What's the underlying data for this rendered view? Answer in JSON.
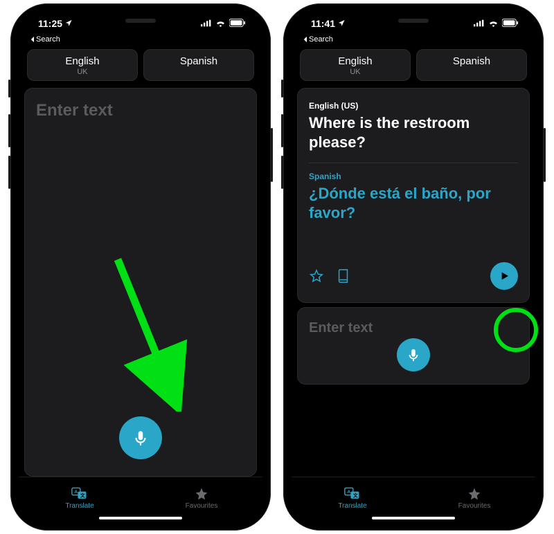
{
  "colors": {
    "accent": "#2aa6c9",
    "annotation": "#00e015"
  },
  "left": {
    "status": {
      "time": "11:25",
      "back_label": "Search"
    },
    "lang_from": {
      "name": "English",
      "region": "UK"
    },
    "lang_to": {
      "name": "Spanish",
      "region": ""
    },
    "placeholder": "Enter text",
    "tabs": {
      "translate": "Translate",
      "favourites": "Favourites"
    }
  },
  "right": {
    "status": {
      "time": "11:41",
      "back_label": "Search"
    },
    "lang_from": {
      "name": "English",
      "region": "UK"
    },
    "lang_to": {
      "name": "Spanish",
      "region": ""
    },
    "result": {
      "source_lang": "English (US)",
      "source_text": "Where is the restroom please?",
      "target_lang": "Spanish",
      "target_text": "¿Dónde está el baño, por favor?"
    },
    "placeholder": "Enter text",
    "tabs": {
      "translate": "Translate",
      "favourites": "Favourites"
    }
  }
}
